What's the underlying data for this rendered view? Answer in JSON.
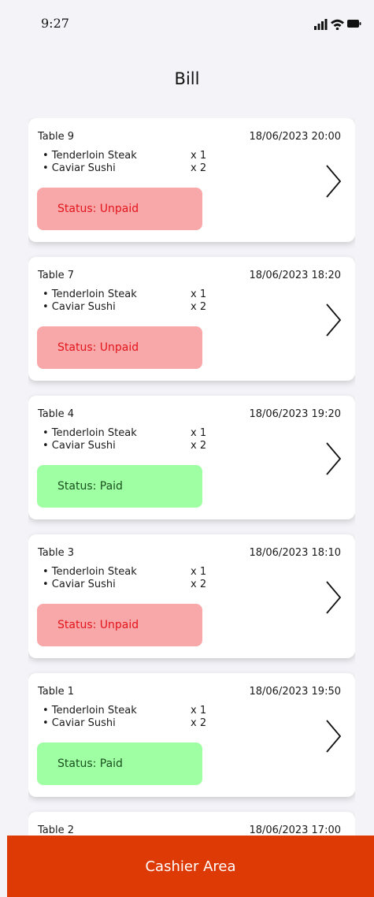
{
  "status_bar": {
    "time": "9:27"
  },
  "page": {
    "title": "Bill"
  },
  "bills": [
    {
      "table": "Table 9",
      "datetime": "18/06/2023 20:00",
      "status": "Status: Unpaid",
      "status_type": "unpaid",
      "items": [
        {
          "name": "• Tenderloin Steak",
          "qty": "x 1"
        },
        {
          "name": "• Caviar Sushi",
          "qty": "x 2"
        }
      ]
    },
    {
      "table": "Table 7",
      "datetime": "18/06/2023 18:20",
      "status": "Status: Unpaid",
      "status_type": "unpaid",
      "items": [
        {
          "name": "• Tenderloin Steak",
          "qty": "x 1"
        },
        {
          "name": "• Caviar Sushi",
          "qty": "x 2"
        }
      ]
    },
    {
      "table": "Table 4",
      "datetime": "18/06/2023 19:20",
      "status": "Status: Paid",
      "status_type": "paid",
      "items": [
        {
          "name": "• Tenderloin Steak",
          "qty": "x 1"
        },
        {
          "name": "• Caviar Sushi",
          "qty": "x 2"
        }
      ]
    },
    {
      "table": "Table 3",
      "datetime": "18/06/2023 18:10",
      "status": "Status: Unpaid",
      "status_type": "unpaid",
      "items": [
        {
          "name": "• Tenderloin Steak",
          "qty": "x 1"
        },
        {
          "name": "• Caviar Sushi",
          "qty": "x 2"
        }
      ]
    },
    {
      "table": "Table 1",
      "datetime": "18/06/2023 19:50",
      "status": "Status: Paid",
      "status_type": "paid",
      "items": [
        {
          "name": "• Tenderloin Steak",
          "qty": "x 1"
        },
        {
          "name": "• Caviar Sushi",
          "qty": "x 2"
        }
      ]
    },
    {
      "table": "Table 2",
      "datetime": "18/06/2023 17:00",
      "status": "",
      "status_type": "",
      "items": []
    }
  ],
  "footer": {
    "cashier_label": "Cashier Area"
  },
  "colors": {
    "unpaid_bg": "#f8a8a8",
    "unpaid_text": "#e3151c",
    "paid_bg": "#9effa3",
    "paid_text": "#1a4f1e",
    "cashier_button": "#de3a06"
  },
  "icons": {
    "chevron": "chevron-right-icon",
    "signal": "signal-icon",
    "wifi": "wifi-icon",
    "battery": "battery-icon"
  }
}
